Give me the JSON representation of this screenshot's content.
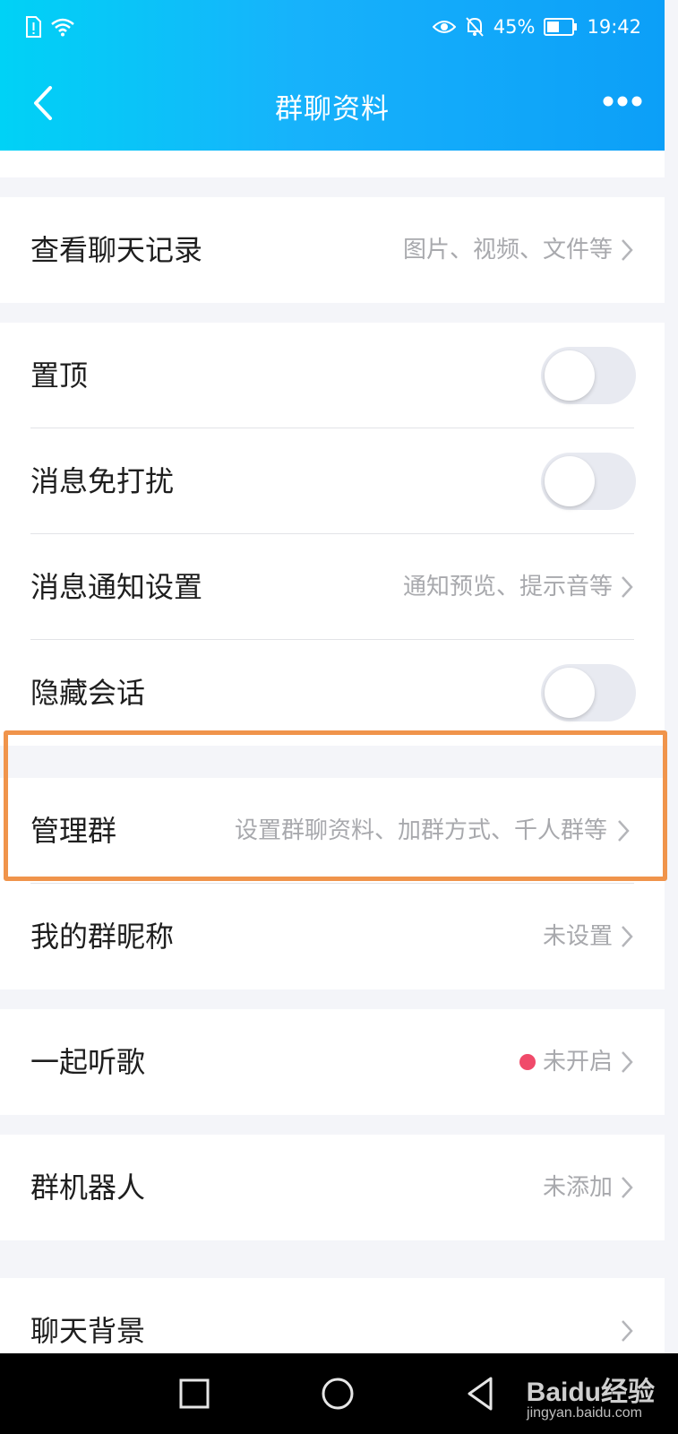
{
  "status_bar": {
    "battery": "45%",
    "time": "19:42",
    "icons": [
      "sim-alert-icon",
      "wifi-icon",
      "eye-icon",
      "mute-bell-icon",
      "battery-icon"
    ]
  },
  "header": {
    "title": "群聊资料",
    "back_icon": "back-arrow-icon",
    "more_icon": "more-dots-icon",
    "gradient_colors": [
      "#00d2f6",
      "#0c9ff8"
    ]
  },
  "sections": {
    "chat_history": {
      "label": "查看聊天记录",
      "value": "图片、视频、文件等"
    },
    "pin_top": {
      "label": "置顶",
      "enabled": false
    },
    "mute": {
      "label": "消息免打扰",
      "enabled": false
    },
    "notify_settings": {
      "label": "消息通知设置",
      "value": "通知预览、提示音等"
    },
    "hide_chat": {
      "label": "隐藏会话",
      "enabled": false
    },
    "manage_group": {
      "label": "管理群",
      "value": "设置群聊资料、加群方式、千人群等"
    },
    "my_nickname": {
      "label": "我的群昵称",
      "value": "未设置"
    },
    "listen_together": {
      "label": "一起听歌",
      "value": "未开启"
    },
    "group_robot": {
      "label": "群机器人",
      "value": "未添加"
    },
    "chat_background": {
      "label": "聊天背景"
    }
  },
  "highlight_color": "#f0944b",
  "watermark": {
    "brand": "Baidu经验",
    "site": "jingyan.baidu.com"
  }
}
